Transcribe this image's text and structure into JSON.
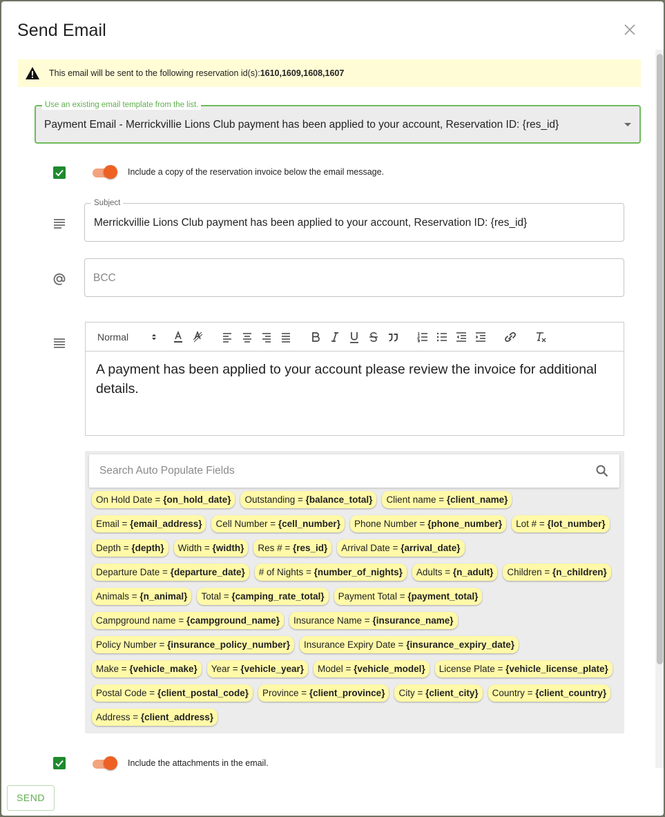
{
  "dialog": {
    "title": "Send Email"
  },
  "alert": {
    "text": "This email will be sent to the following reservation id(s): ",
    "ids": "1610,1609,1608,1607"
  },
  "template": {
    "label": "Use an existing email template from the list.",
    "value": "Payment Email - Merrickvillie Lions Club payment has been applied to your account, Reservation ID: {res_id}"
  },
  "invoice_option": {
    "label": "Include a copy of the reservation invoice below the email message.",
    "checked": true,
    "toggle_on": true
  },
  "subject": {
    "label": "Subject",
    "value": "Merrickvillie Lions Club payment has been applied to your account, Reservation ID: {res_id}"
  },
  "bcc": {
    "placeholder": "BCC",
    "value": ""
  },
  "editor": {
    "format": "Normal",
    "body": "A payment has been applied to your account please review the invoice for additional details."
  },
  "autopopulate": {
    "search_placeholder": "Search Auto Populate Fields",
    "rows": [
      [
        {
          "label": "On Hold Date = ",
          "token": "{on_hold_date}"
        },
        {
          "label": "Outstanding = ",
          "token": "{balance_total}"
        },
        {
          "label": "Client name = ",
          "token": "{client_name}"
        }
      ],
      [
        {
          "label": "Email = ",
          "token": "{email_address}"
        },
        {
          "label": "Cell Number = ",
          "token": "{cell_number}"
        },
        {
          "label": "Phone Number = ",
          "token": "{phone_number}"
        },
        {
          "label": "Lot # = ",
          "token": "{lot_number}"
        }
      ],
      [
        {
          "label": "Depth = ",
          "token": "{depth}"
        },
        {
          "label": "Width = ",
          "token": "{width}"
        },
        {
          "label": "Res # = ",
          "token": "{res_id}"
        },
        {
          "label": "Arrival Date = ",
          "token": "{arrival_date}"
        }
      ],
      [
        {
          "label": "Departure Date = ",
          "token": "{departure_date}"
        },
        {
          "label": "# of Nights = ",
          "token": "{number_of_nights}"
        },
        {
          "label": "Adults = ",
          "token": "{n_adult}"
        },
        {
          "label": "Children = ",
          "token": "{n_children}"
        }
      ],
      [
        {
          "label": "Animals = ",
          "token": "{n_animal}"
        },
        {
          "label": "Total = ",
          "token": "{camping_rate_total}"
        },
        {
          "label": "Payment Total = ",
          "token": "{payment_total}"
        }
      ],
      [
        {
          "label": "Campground name = ",
          "token": "{campground_name}"
        },
        {
          "label": "Insurance Name = ",
          "token": "{insurance_name}"
        }
      ],
      [
        {
          "label": "Policy Number = ",
          "token": "{insurance_policy_number}"
        },
        {
          "label": "Insurance Expiry Date = ",
          "token": "{insurance_expiry_date}"
        }
      ],
      [
        {
          "label": "Make = ",
          "token": "{vehicle_make}"
        },
        {
          "label": "Year = ",
          "token": "{vehicle_year}"
        },
        {
          "label": "Model = ",
          "token": "{vehicle_model}"
        },
        {
          "label": "License Plate = ",
          "token": "{vehicle_license_plate}"
        }
      ],
      [
        {
          "label": "Postal Code = ",
          "token": "{client_postal_code}"
        },
        {
          "label": "Province = ",
          "token": "{client_province}"
        },
        {
          "label": "City = ",
          "token": "{client_city}"
        },
        {
          "label": "Country = ",
          "token": "{client_country}"
        }
      ],
      [
        {
          "label": "Address = ",
          "token": "{client_address}"
        }
      ]
    ]
  },
  "attachments_option": {
    "label": "Include the attachments in the email.",
    "checked": true,
    "toggle_on": true
  },
  "actions": {
    "send_label": "SEND"
  },
  "icons": {
    "warning": "warning-icon",
    "close": "close-icon",
    "subject": "subject-lines-icon",
    "bcc": "at-sign-icon",
    "body": "body-lines-icon",
    "search": "search-icon",
    "check": "checkmark-icon"
  },
  "colors": {
    "accent_green": "#5fae4e",
    "checkbox_green": "#1e8a2e",
    "toggle_orange": "#ee6123",
    "alert_bg": "#fffcd6",
    "chip_bg": "#fff9a8"
  }
}
